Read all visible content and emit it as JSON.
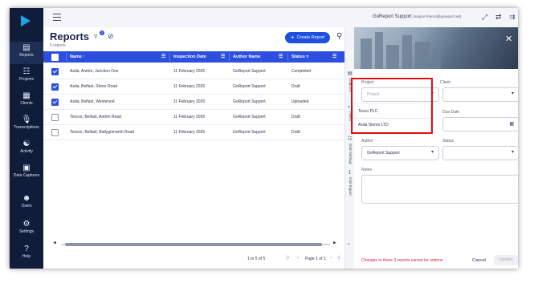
{
  "sidebar": {
    "items": [
      {
        "label": "Reports",
        "icon": "document-icon",
        "active": true
      },
      {
        "label": "Projects",
        "icon": "projects-icon"
      },
      {
        "label": "Clients",
        "icon": "clients-icon"
      },
      {
        "label": "Transcriptions",
        "icon": "microphone-icon"
      },
      {
        "label": "Activity",
        "icon": "activity-icon"
      },
      {
        "label": "Data Captures",
        "icon": "data-captures-icon"
      },
      {
        "label": "Users",
        "icon": "users-icon"
      },
      {
        "label": "Settings",
        "icon": "gear-icon"
      },
      {
        "label": "Help",
        "icon": "help-icon"
      }
    ]
  },
  "topbar": {
    "user_name": "GoReport Support",
    "user_email": "(support-heron@goreport.net)"
  },
  "reports": {
    "title": "Reports",
    "count_text": "5 reports",
    "filter_badge": "2",
    "create_label": "Create Report",
    "columns": {
      "name": "Name",
      "inspection_date": "Inspection Date",
      "author_name": "Author Name",
      "status": "Status"
    },
    "rows": [
      {
        "name": "Asda, Antrim, Junction One",
        "date": "11 February 2026",
        "author": "GoReport Support",
        "status": "Completed",
        "checked": true
      },
      {
        "name": "Asda, Belfast, Shore Road",
        "date": "11 February 2026",
        "author": "GoReport Support",
        "status": "Draft",
        "checked": true
      },
      {
        "name": "Asda, Belfast, Westwood",
        "date": "11 February 2026",
        "author": "GoReport Support",
        "status": "Uploaded",
        "checked": true
      },
      {
        "name": "Tescos, Belfast, Antrim Road",
        "date": "11 February 2026",
        "author": "GoReport Support",
        "status": "Draft",
        "checked": false
      },
      {
        "name": "Tescos, Belfast, Ballygomartin Road",
        "date": "11 February 2026",
        "author": "GoReport Support",
        "status": "Draft",
        "checked": false
      }
    ],
    "pager": {
      "range_text": "1 to 5 of 5",
      "page_text": "Page 1 of 1"
    }
  },
  "side_tabs": [
    "Columns",
    "Filters",
    "Grid Settings",
    "Grid Export"
  ],
  "panel": {
    "project_label": "Project",
    "project_placeholder": "Project",
    "client_label": "Client",
    "due_date_label": "Due Date",
    "author_label": "Author",
    "author_value": "GoReport Support",
    "status_label": "Status",
    "notes_label": "Notes",
    "project_options": [
      "Tesco PLC",
      "Asda Stores LTD"
    ],
    "warning_text": "Changes to these 3 reports cannot be undone",
    "cancel_label": "Cancel",
    "update_label": "Update"
  },
  "colors": {
    "sidebar_bg": "#0f1d3a",
    "accent": "#2c4fe0",
    "highlight": "#e01010",
    "warning": "#d0243a"
  }
}
